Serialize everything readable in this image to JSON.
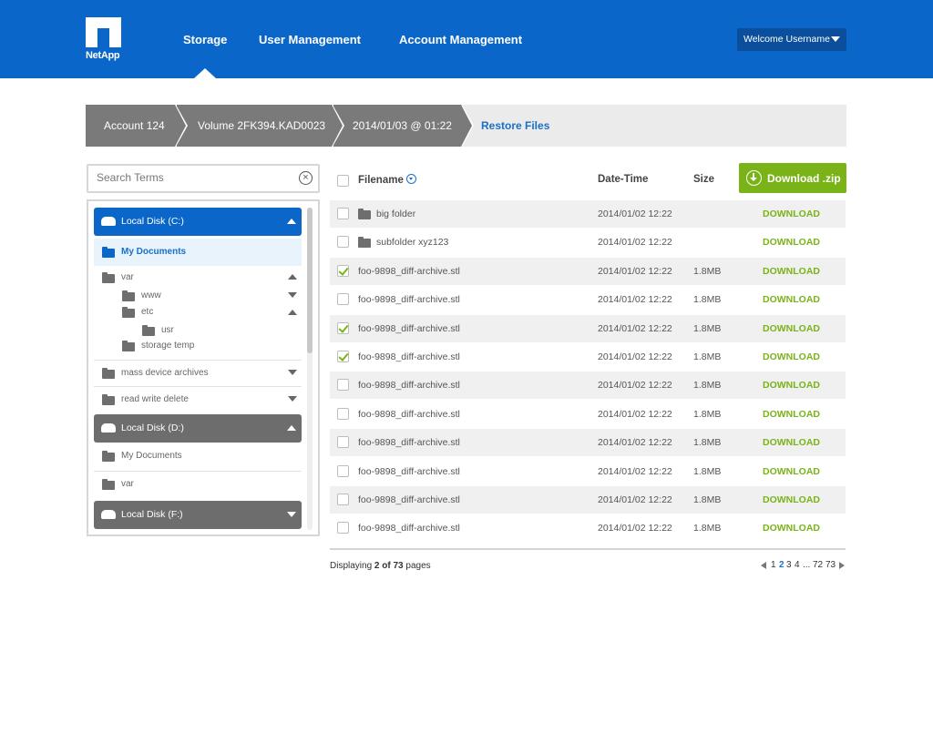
{
  "header": {
    "logo_text": "NetApp",
    "nav": [
      "Storage",
      "User Management",
      "Account Management"
    ],
    "active_nav": "Storage",
    "welcome": "Welcome Username"
  },
  "breadcrumb": {
    "items": [
      "Account 124",
      "Volume 2FK394.KAD0023",
      "2014/01/03 @ 01:22"
    ],
    "current": "Restore Files"
  },
  "search": {
    "placeholder": "Search Terms"
  },
  "tree": {
    "disk_c": "Local Disk (C:)",
    "my_documents": "My Documents",
    "var": "var",
    "www": "www",
    "etc": "etc",
    "usr": "usr",
    "storage_temp": "storage temp",
    "mass_device_archives": "mass device archives",
    "read_write_delete": "read write delete",
    "disk_d": "Local Disk (D:)",
    "d_my_documents": "My Documents",
    "d_var": "var",
    "disk_f": "Local Disk (F:)"
  },
  "table": {
    "headers": {
      "filename": "Filename",
      "datetime": "Date-Time",
      "size": "Size"
    },
    "download_zip": "Download .zip",
    "download_label": "DOWNLOAD",
    "rows": [
      {
        "name": "big folder",
        "date": "2014/01/02 12:22",
        "size": "",
        "folder": true,
        "checked": false
      },
      {
        "name": "subfolder xyz123",
        "date": "2014/01/02 12:22",
        "size": "",
        "folder": true,
        "checked": false
      },
      {
        "name": "foo-9898_diff-archive.stl",
        "date": "2014/01/02 12:22",
        "size": "1.8MB",
        "folder": false,
        "checked": true
      },
      {
        "name": "foo-9898_diff-archive.stl",
        "date": "2014/01/02 12:22",
        "size": "1.8MB",
        "folder": false,
        "checked": false
      },
      {
        "name": "foo-9898_diff-archive.stl",
        "date": "2014/01/02 12:22",
        "size": "1.8MB",
        "folder": false,
        "checked": true
      },
      {
        "name": "foo-9898_diff-archive.stl",
        "date": "2014/01/02 12:22",
        "size": "1.8MB",
        "folder": false,
        "checked": true
      },
      {
        "name": "foo-9898_diff-archive.stl",
        "date": "2014/01/02 12:22",
        "size": "1.8MB",
        "folder": false,
        "checked": false
      },
      {
        "name": "foo-9898_diff-archive.stl",
        "date": "2014/01/02 12:22",
        "size": "1.8MB",
        "folder": false,
        "checked": false
      },
      {
        "name": "foo-9898_diff-archive.stl",
        "date": "2014/01/02 12:22",
        "size": "1.8MB",
        "folder": false,
        "checked": false
      },
      {
        "name": "foo-9898_diff-archive.stl",
        "date": "2014/01/02 12:22",
        "size": "1.8MB",
        "folder": false,
        "checked": false
      },
      {
        "name": "foo-9898_diff-archive.stl",
        "date": "2014/01/02 12:22",
        "size": "1.8MB",
        "folder": false,
        "checked": false
      },
      {
        "name": "foo-9898_diff-archive.stl",
        "date": "2014/01/02 12:22",
        "size": "1.8MB",
        "folder": false,
        "checked": false
      }
    ]
  },
  "footer": {
    "displaying_prefix": "Displaying ",
    "displaying_pages": "2 of 73",
    "displaying_suffix": " pages",
    "pages": [
      "1",
      "2",
      "3",
      "4",
      "...",
      "72",
      "73"
    ],
    "current_page": "2"
  },
  "colors": {
    "brand_blue": "#0a67c9",
    "accent_green": "#7ab317",
    "crumb_gray": "#7a7a7a"
  }
}
